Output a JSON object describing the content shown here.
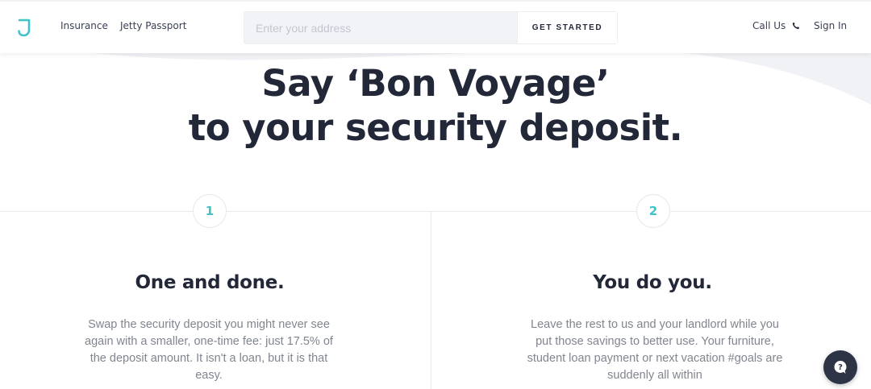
{
  "header": {
    "nav": [
      {
        "label": "Insurance"
      },
      {
        "label": "Jetty Passport"
      }
    ],
    "address": {
      "placeholder": "Enter your address",
      "value": ""
    },
    "cta_label": "GET STARTED",
    "call_us_label": "Call Us",
    "sign_in_label": "Sign In",
    "logo_icon": "jetty-j-logo",
    "phone_icon": "phone-icon"
  },
  "hero": {
    "line1": "Say ‘Bon Voyage’",
    "line2": "to your security deposit."
  },
  "steps": [
    {
      "number": "1",
      "title": "One and done.",
      "text": "Swap the security deposit you might never see again with a smaller, one-time fee: just 17.5% of the deposit amount. It isn't a loan, but it is that easy."
    },
    {
      "number": "2",
      "title": "You do you.",
      "text": "Leave the rest to us and your landlord while you put those savings to better use. Your furniture, student loan payment or next vacation #goals are suddenly all within"
    }
  ],
  "chat": {
    "icon": "chat-bubble-icon"
  },
  "colors": {
    "accent": "#3fc3c8",
    "text_dark": "#232838",
    "text_muted": "#80858f",
    "chat_bg": "#2d3446"
  }
}
